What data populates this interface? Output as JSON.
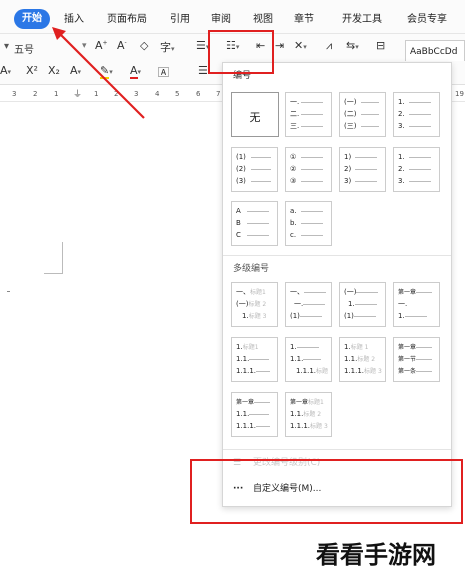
{
  "ribbon": {
    "tabs": [
      "开始",
      "插入",
      "页面布局",
      "引用",
      "审阅",
      "视图",
      "章节",
      "开发工具",
      "会员专享"
    ],
    "font_size": "五号",
    "style_preview": "AaBbCcDd",
    "icons": [
      "grow-font-icon",
      "shrink-font-icon",
      "clear-format-icon",
      "phonetic-icon",
      "bullet-list-icon",
      "numbered-list-icon",
      "decrease-indent-icon",
      "increase-indent-icon",
      "chinese-layout-icon",
      "sort-icon",
      "show-marks-icon",
      "table-border-icon",
      "strikethrough-icon",
      "superscript-icon",
      "subscript-icon",
      "text-effect-icon",
      "highlight-icon",
      "font-color-icon",
      "char-border-icon",
      "align-left-icon"
    ]
  },
  "ruler": {
    "numbers": [
      "3",
      "2",
      "1",
      "1",
      "2",
      "3",
      "4",
      "5",
      "6",
      "7",
      "19"
    ]
  },
  "popup": {
    "header": "编号",
    "section_multilevel": "多级编号",
    "none_label": "无",
    "single": [
      [
        [
          "一.",
          "二.",
          "三."
        ],
        [
          "(一)",
          "(二)",
          "(三)"
        ],
        [
          "1.",
          "2.",
          "3."
        ]
      ],
      [
        [
          "(1)",
          "(2)",
          "(3)"
        ],
        [
          "①",
          "②",
          "③"
        ],
        [
          "1)",
          "2)",
          "3)"
        ],
        [
          "1.",
          "2.",
          "3."
        ]
      ],
      [
        [
          "A",
          "B",
          "C"
        ],
        [
          "a.",
          "b.",
          "c."
        ]
      ]
    ],
    "multi": [
      [
        [
          [
            "一、",
            "标题1"
          ],
          [
            "(一)",
            "标题 2"
          ],
          [
            "1.",
            "标题 3"
          ]
        ],
        [
          [
            "一、",
            ""
          ],
          [
            "一.",
            ""
          ],
          [
            "(1)",
            ""
          ]
        ],
        [
          [
            "(一)",
            ""
          ],
          [
            "1.",
            ""
          ],
          [
            "(1)",
            ""
          ]
        ],
        [
          [
            "第一章",
            ""
          ],
          [
            "一.",
            ""
          ],
          [
            "1.",
            ""
          ]
        ]
      ],
      [
        [
          [
            "1.",
            "标题1"
          ],
          [
            "1.1.",
            ""
          ],
          [
            "1.1.1.",
            ""
          ]
        ],
        [
          [
            "1.",
            ""
          ],
          [
            "1.1.",
            ""
          ],
          [
            "1.1.1.",
            "标题"
          ]
        ],
        [
          [
            "1.",
            "标题 1"
          ],
          [
            "1.1.",
            "标题 2"
          ],
          [
            "1.1.1.",
            "标题 3"
          ]
        ],
        [
          [
            "第一章",
            ""
          ],
          [
            "第一节",
            ""
          ],
          [
            "第一条",
            ""
          ]
        ]
      ],
      [
        [
          [
            "第一章",
            ""
          ],
          [
            "1.1.",
            ""
          ],
          [
            "1.1.1.",
            ""
          ]
        ],
        [
          [
            "第一章",
            "标题1"
          ],
          [
            "1.1.",
            "标题 2"
          ],
          [
            "1.1.1.",
            "标题 3"
          ]
        ]
      ]
    ],
    "partial_item": "更改编号级别(C)",
    "custom_item": "自定义编号(M)..."
  },
  "watermark": "看看手游网",
  "colors": {
    "annotation": "#e02020",
    "accent": "#2b77e6"
  }
}
